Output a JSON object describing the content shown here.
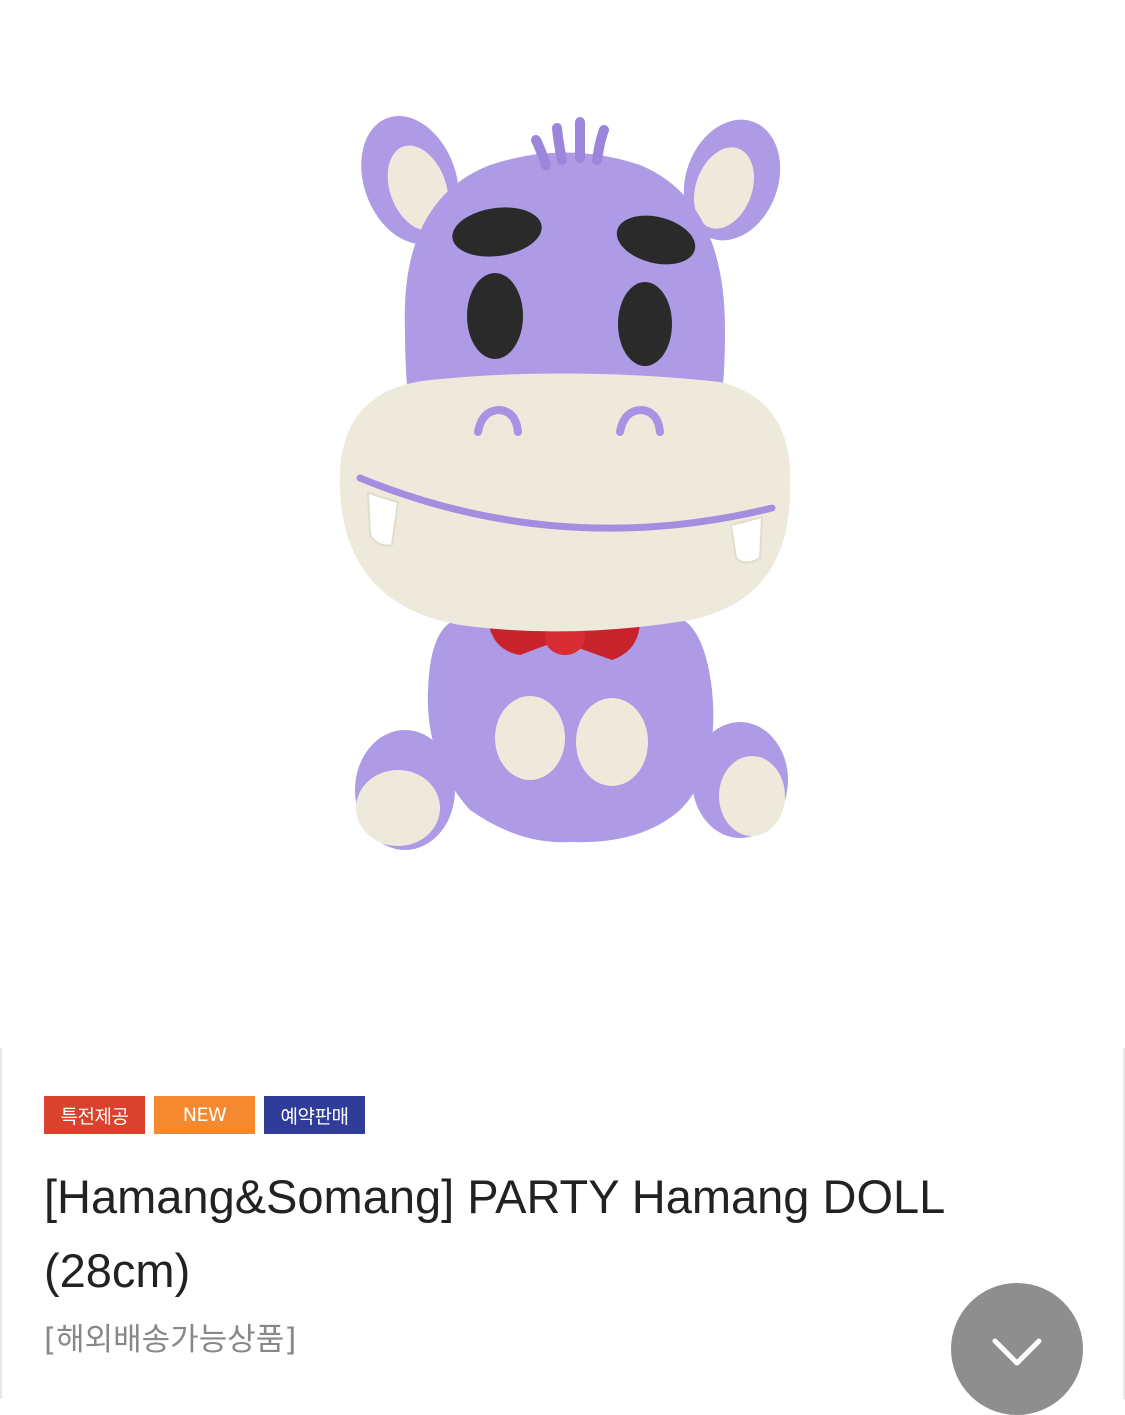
{
  "product_image": {
    "subject": "purple hippo plush doll"
  },
  "badges": [
    {
      "label": "특전제공",
      "color": "#d9432e"
    },
    {
      "label": "NEW",
      "color": "#f5892f"
    },
    {
      "label": "예약판매",
      "color": "#2f3c9a"
    }
  ],
  "product": {
    "title": "[Hamang&Somang] PARTY Hamang DOLL (28cm)",
    "shipping_note": "[해외배송가능상품]"
  },
  "scroll_button": {
    "icon": "chevron-down-icon"
  }
}
